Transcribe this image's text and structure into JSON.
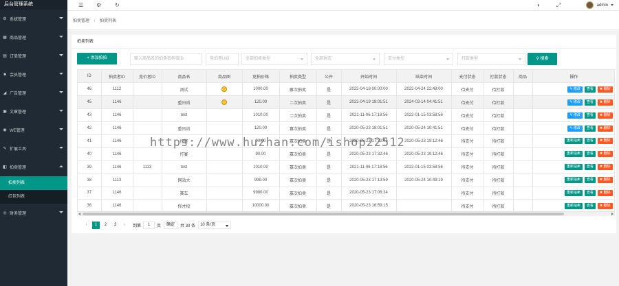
{
  "app": {
    "title": "后台管理系统"
  },
  "sidebar": {
    "items": [
      {
        "label": "系统管理",
        "icon": "gear-icon",
        "glyph": "⚙"
      },
      {
        "label": "商品管理",
        "icon": "box-icon",
        "glyph": "▦"
      },
      {
        "label": "订单管理",
        "icon": "document-icon",
        "glyph": "▤"
      },
      {
        "label": "会员管理",
        "icon": "users-icon",
        "glyph": "☻"
      },
      {
        "label": "广告管理",
        "icon": "megaphone-icon",
        "glyph": "◢"
      },
      {
        "label": "文章管理",
        "icon": "article-icon",
        "glyph": "▣"
      },
      {
        "label": "WE管理",
        "icon": "wechat-icon",
        "glyph": "◉"
      },
      {
        "label": "扩展工具",
        "icon": "wrench-icon",
        "glyph": "✎"
      },
      {
        "label": "拍卖管理",
        "icon": "gavel-icon",
        "glyph": "◧"
      }
    ],
    "sub_items": [
      {
        "label": "拍卖列表"
      },
      {
        "label": "红包列表"
      }
    ],
    "last_item": {
      "label": "财务管理",
      "icon": "finance-icon",
      "glyph": "◎"
    }
  },
  "topbar": {
    "user": "admin"
  },
  "breadcrumb": {
    "root": "拍卖管理",
    "current": "拍卖列表"
  },
  "card": {
    "title": "拍卖列表"
  },
  "filters": {
    "add_label": "添加拍拍",
    "search_placeholder": "输入商品名的拍卖名称或ID",
    "order_placeholder": "竞拍者UID",
    "type_select": "全部拍卖类型",
    "status_select": "全部状态",
    "pay_select": "支付类型",
    "punch_select": "打款类型",
    "search_label": "搜索"
  },
  "table": {
    "headers": [
      "ID",
      "拍卖者ID",
      "竞价者ID",
      "商品名",
      "商品图",
      "竞拍价格",
      "拍卖类型",
      "公开",
      "开始时间",
      "结束时间",
      "支付状态",
      "打款状态",
      "商品",
      "操作"
    ],
    "rows": [
      {
        "id": "46",
        "seller": "1112",
        "bidder": "",
        "name": "测试",
        "img": true,
        "price": "1000.00",
        "type": "寡次拍卖",
        "pub": "是",
        "start": "2022-04-18 00:00:00",
        "end": "2022-04-24 22:48:00",
        "pay": "待支付",
        "punch": "待打款",
        "goods": "",
        "ops": [
          "修改",
          "查看",
          "删除"
        ],
        "hl": false
      },
      {
        "id": "45",
        "seller": "1146",
        "bidder": "",
        "name": "重日尚",
        "img": true,
        "price": "120.00",
        "type": "二次拍卖",
        "pub": "是",
        "start": "2022-04-19 18:01:51",
        "end": "2024-03-14 04:41:51",
        "pay": "待支付",
        "punch": "待打款",
        "goods": "",
        "ops": [
          "修改",
          "查看",
          "删除"
        ],
        "hl": true
      },
      {
        "id": "43",
        "seller": "1146",
        "bidder": "",
        "name": "test",
        "img": false,
        "price": "1010.00",
        "type": "二次拍卖",
        "pub": "是",
        "start": "2021-11-06 17:18:56",
        "end": "2022-01-15 03:58:56",
        "pay": "待支付",
        "punch": "待打款",
        "goods": "",
        "ops": [
          "修改",
          "查看",
          "删除"
        ],
        "hl": false
      },
      {
        "id": "42",
        "seller": "1146",
        "bidder": "",
        "name": "重日尚",
        "img": false,
        "price": "120.00",
        "type": "寡次拍卖",
        "pub": "是",
        "start": "2020-05-23 18:01:51",
        "end": "2020-05-24 10:41:51",
        "pay": "待支付",
        "punch": "待打款",
        "goods": "",
        "ops": [
          "修改",
          "查看",
          "删除"
        ],
        "hl": false
      },
      {
        "id": "41",
        "seller": "1146",
        "bidder": "",
        "name": "打宴",
        "img": false,
        "price": "90.00",
        "type": "寡次拍卖",
        "pub": "是",
        "start": "2020-05-23 17:32:46",
        "end": "2020-05-23 19:12:46",
        "pay": "待支付",
        "punch": "待打款",
        "goods": "",
        "ops": [
          "重新拍卖",
          "查看",
          "删除"
        ],
        "hl": false
      },
      {
        "id": "40",
        "seller": "1146",
        "bidder": "",
        "name": "打宴",
        "img": false,
        "price": "90.00",
        "type": "寡次拍卖",
        "pub": "是",
        "start": "2020-05-23 17:32:46",
        "end": "2020-05-23 19:12:46",
        "pay": "待支付",
        "punch": "待打款",
        "goods": "",
        "ops": [
          "重新拍卖",
          "查看",
          "删除"
        ],
        "hl": false
      },
      {
        "id": "39",
        "seller": "1146",
        "bidder": "1113",
        "name": "test",
        "img": false,
        "price": "1010.00",
        "type": "寡次拍卖",
        "pub": "是",
        "start": "2021-11-06 17:18:56",
        "end": "2022-01-15 03:58:56",
        "pay": "待支付",
        "punch": "待打款",
        "goods": "",
        "ops": [
          "重新拍卖",
          "查看",
          "删除"
        ],
        "hl": false
      },
      {
        "id": "38",
        "seller": "1113",
        "bidder": "",
        "name": "网站大",
        "img": false,
        "price": "999.00",
        "type": "寡次拍卖",
        "pub": "是",
        "start": "2020-05-23 17:13:59",
        "end": "2020-05-24 10:49:19",
        "pay": "待支付",
        "punch": "待打款",
        "goods": "",
        "ops": [
          "重新拍卖",
          "查看",
          "删除"
        ],
        "hl": false
      },
      {
        "id": "37",
        "seller": "1146",
        "bidder": "",
        "name": "赛车",
        "img": false,
        "price": "9980.00",
        "type": "寡次拍卖",
        "pub": "是",
        "start": "2020-05-23 17:06:34",
        "end": "",
        "pay": "待支付",
        "punch": "待打款",
        "goods": "",
        "ops": [
          "重新拍卖",
          "查看",
          "删除"
        ],
        "hl": false
      },
      {
        "id": "36",
        "seller": "1146",
        "bidder": "",
        "name": "你才校",
        "img": false,
        "price": "10000.00",
        "type": "寡次拍卖",
        "pub": "是",
        "start": "2020-05-23 16:59:15",
        "end": "",
        "pay": "待支付",
        "punch": "待打款",
        "goods": "",
        "ops": [
          "重新拍卖",
          "查看",
          "删除"
        ],
        "hl": false
      }
    ]
  },
  "pager": {
    "pages": [
      "1",
      "2",
      "3"
    ],
    "goto_label": "到第",
    "goto_value": "1",
    "page_unit": "页",
    "confirm_label": "确定",
    "total_label": "共 30 条",
    "page_size": "10 条/页"
  },
  "watermark": "https://www.huzhan.com/ishop22512",
  "colors": {
    "accent": "#009688",
    "sidebar": "#1f2a35",
    "blue": "#1e9fff",
    "red": "#ff5722"
  }
}
